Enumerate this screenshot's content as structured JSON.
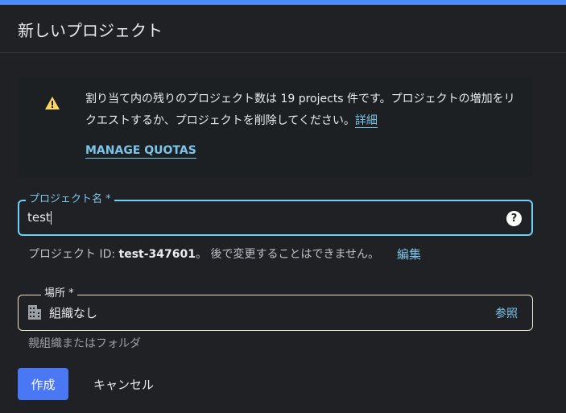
{
  "dialog": {
    "title": "新しいプロジェクト"
  },
  "quota": {
    "message": "割り当て内の残りのプロジェクト数は 19 projects 件です。プロジェクトの増加をリクエストするか、プロジェクトを削除してください。",
    "details_link": "詳細",
    "manage_label": "MANAGE QUOTAS",
    "icon": "warning-icon",
    "icon_color": "#fdd663"
  },
  "project_name": {
    "label": "プロジェクト名 *",
    "value": "test",
    "help_icon": "help-icon"
  },
  "project_id": {
    "prefix": "プロジェクト ID: ",
    "id": "test-347601",
    "suffix": "。 後で変更することはできません。",
    "edit_label": "編集"
  },
  "location": {
    "label": "場所 *",
    "value": "組織なし",
    "browse_label": "参照",
    "hint": "親組織またはフォルダ",
    "icon": "building-icon"
  },
  "actions": {
    "create_label": "作成",
    "cancel_label": "キャンセル"
  },
  "colors": {
    "accent": "#4a78f5",
    "link": "#7cc4e8",
    "background": "#202124"
  }
}
